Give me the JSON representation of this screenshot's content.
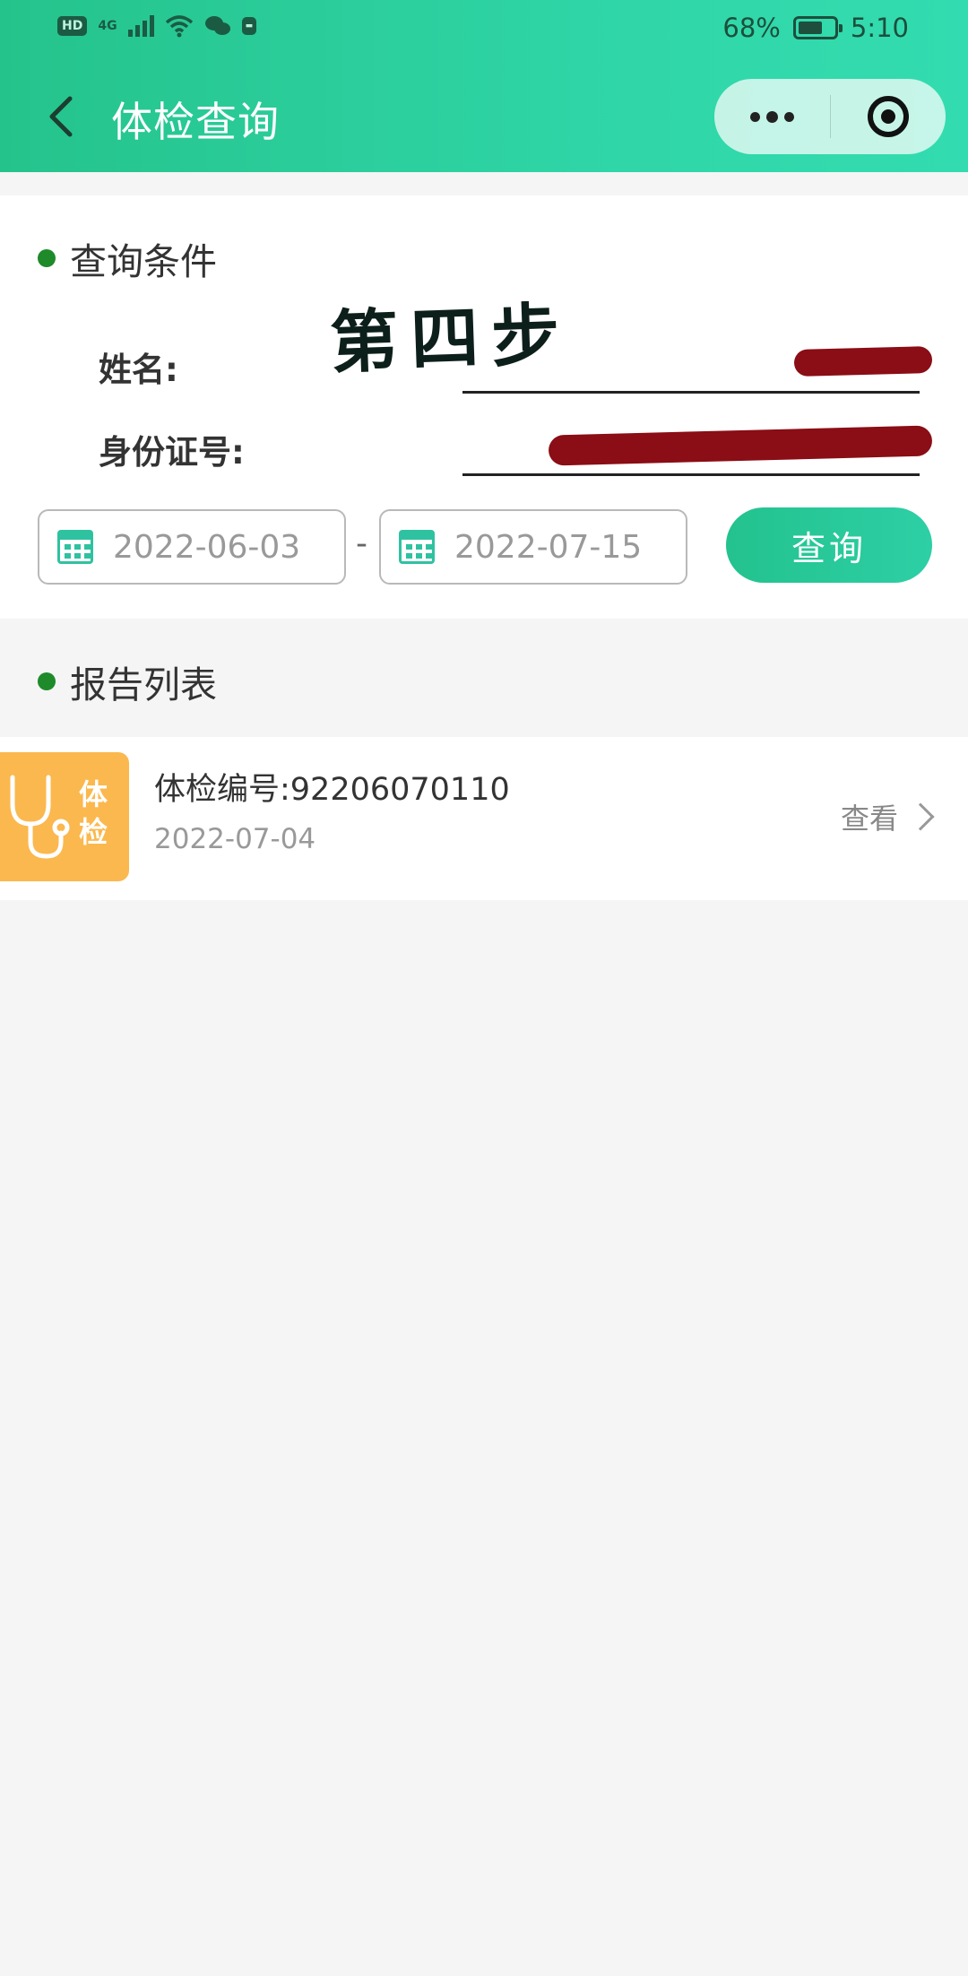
{
  "status_bar": {
    "badge": "HD",
    "network": "4G",
    "battery_text": "68%",
    "battery_level": 0.68,
    "time": "5:10"
  },
  "nav": {
    "title": "体检查询",
    "back_icon": "chevron-left-icon",
    "more_icon": "more-dots-icon",
    "close_icon": "target-circle-icon"
  },
  "query": {
    "section_title": "查询条件",
    "annotation": "第四步",
    "name_label": "姓名:",
    "id_label": "身份证号:",
    "start_date": "2022-06-03",
    "date_separator": "-",
    "end_date": "2022-07-15",
    "button_label": "查询"
  },
  "report_list": {
    "section_title": "报告列表",
    "items": [
      {
        "thumb_text": "体检",
        "number": "体检编号:92206070110",
        "date": "2022-07-04",
        "action_label": "查看"
      }
    ]
  },
  "colors": {
    "header_gradient_start": "#25c38c",
    "header_gradient_end": "#33dcb0",
    "section_dot": "#1e8a2a",
    "thumb_bg": "#fbb84e",
    "redaction": "#8b0d15"
  }
}
